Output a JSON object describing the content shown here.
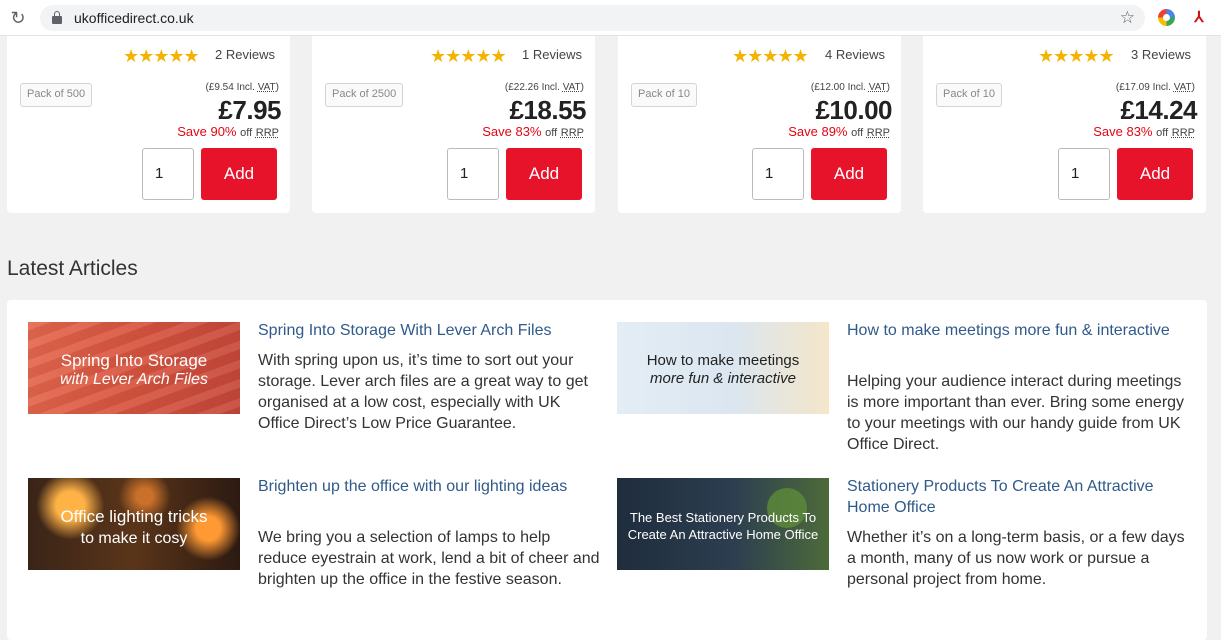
{
  "browser": {
    "url": "ukofficedirect.co.uk"
  },
  "products": [
    {
      "stars": "★★★★★",
      "reviews": "2 Reviews",
      "pack": "Pack of 500",
      "incl_price": "(£9.54 Incl.",
      "incl_vat": "VAT)",
      "price": "£7.95",
      "save": "Save 90%",
      "off": "off",
      "rrp": "RRP",
      "qty": "1",
      "add_label": "Add"
    },
    {
      "stars": "★★★★★",
      "reviews": "1 Reviews",
      "pack": "Pack of 2500",
      "incl_price": "(£22.26 Incl.",
      "incl_vat": "VAT)",
      "price": "£18.55",
      "save": "Save 83%",
      "off": "off",
      "rrp": "RRP",
      "qty": "1",
      "add_label": "Add"
    },
    {
      "stars": "★★★★★",
      "reviews": "4 Reviews",
      "pack": "Pack of 10",
      "incl_price": "(£12.00 Incl.",
      "incl_vat": "VAT)",
      "price": "£10.00",
      "save": "Save 89%",
      "off": "off",
      "rrp": "RRP",
      "qty": "1",
      "add_label": "Add"
    },
    {
      "stars": "★★★★★",
      "reviews": "3 Reviews",
      "pack": "Pack of 10",
      "incl_price": "(£17.09 Incl.",
      "incl_vat": "VAT)",
      "price": "£14.24",
      "save": "Save 83%",
      "off": "off",
      "rrp": "RRP",
      "qty": "1",
      "add_label": "Add"
    }
  ],
  "latest_articles": {
    "heading": "Latest Articles",
    "items": [
      {
        "thumb_line1": "Spring Into Storage",
        "thumb_line2": "with Lever Arch Files",
        "title": "Spring Into Storage With Lever Arch Files",
        "excerpt": "With spring upon us, it’s time to sort out your storage. Lever arch files are a great way to get organised at a low cost, especially with UK Office Direct’s Low Price Guarantee."
      },
      {
        "thumb_line1": "How to make meetings",
        "thumb_line2": "more fun & interactive",
        "title": "How to make meetings more fun & interactive",
        "excerpt": "Helping your audience interact during meetings is more important than ever. Bring some energy to your meetings with our handy guide from UK Office Direct."
      },
      {
        "thumb_line1": "Office lighting tricks",
        "thumb_line2": "to make it cosy",
        "title": "Brighten up the office with our lighting ideas",
        "excerpt": "We bring you a selection of lamps to help reduce eyestrain at work, lend a bit of cheer and brighten up the office in the festive season."
      },
      {
        "thumb_line1": "The Best Stationery Products To",
        "thumb_line2": "Create An Attractive Home Office",
        "title": "Stationery Products To Create An Attractive Home Office",
        "excerpt": "Whether it’s on a long-term basis, or a few days a month, many of us now work or pursue a personal project from home."
      }
    ]
  },
  "colors": {
    "accent": "#e6132b",
    "link": "#2f5a8a",
    "star": "#f5b301",
    "save": "#e30613"
  }
}
